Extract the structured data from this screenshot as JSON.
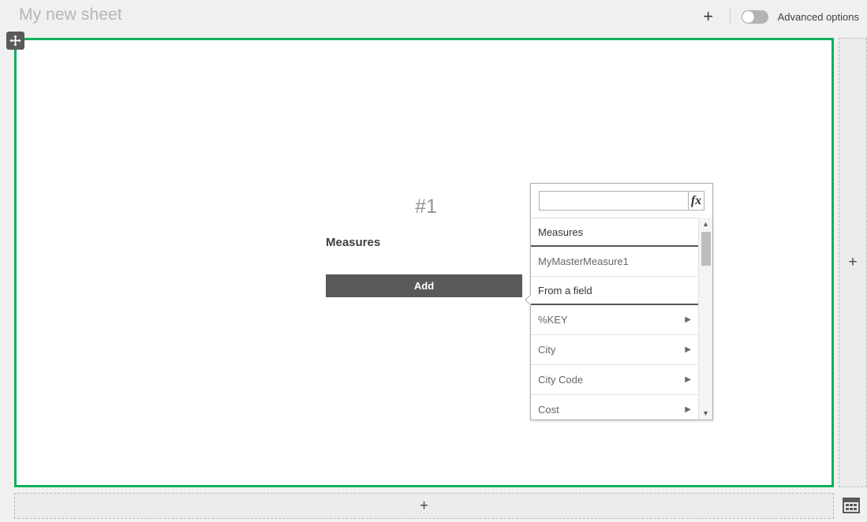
{
  "header": {
    "sheet_title": "My new sheet",
    "add_icon": "plus-icon",
    "advanced_options_label": "Advanced options",
    "advanced_options_state": "off"
  },
  "sheet": {
    "border_color": "#0db05d",
    "drag_handle_icon": "move-arrows-icon"
  },
  "object": {
    "number_label": "#1",
    "measures_label": "Measures",
    "add_button_label": "Add",
    "add_button_color": "#595959"
  },
  "popover": {
    "search_value": "",
    "search_placeholder": "",
    "fx_button_label": "fx",
    "sections": [
      {
        "header": "Measures",
        "items": [
          {
            "label": "MyMasterMeasure1",
            "has_arrow": false
          }
        ]
      },
      {
        "header": "From a field",
        "items": [
          {
            "label": "%KEY",
            "has_arrow": true,
            "arrow": "▶"
          },
          {
            "label": "City",
            "has_arrow": true,
            "arrow": "▶"
          },
          {
            "label": "City Code",
            "has_arrow": true,
            "arrow": "▶"
          },
          {
            "label": "Cost",
            "has_arrow": true,
            "arrow": "▶"
          }
        ]
      }
    ],
    "scrollbar": {
      "up_arrow": "▲",
      "down_arrow": "▼"
    }
  },
  "dropzones": {
    "right_label": "+",
    "bottom_label": "+"
  },
  "footer": {
    "data_table_icon": "data-table-icon"
  }
}
